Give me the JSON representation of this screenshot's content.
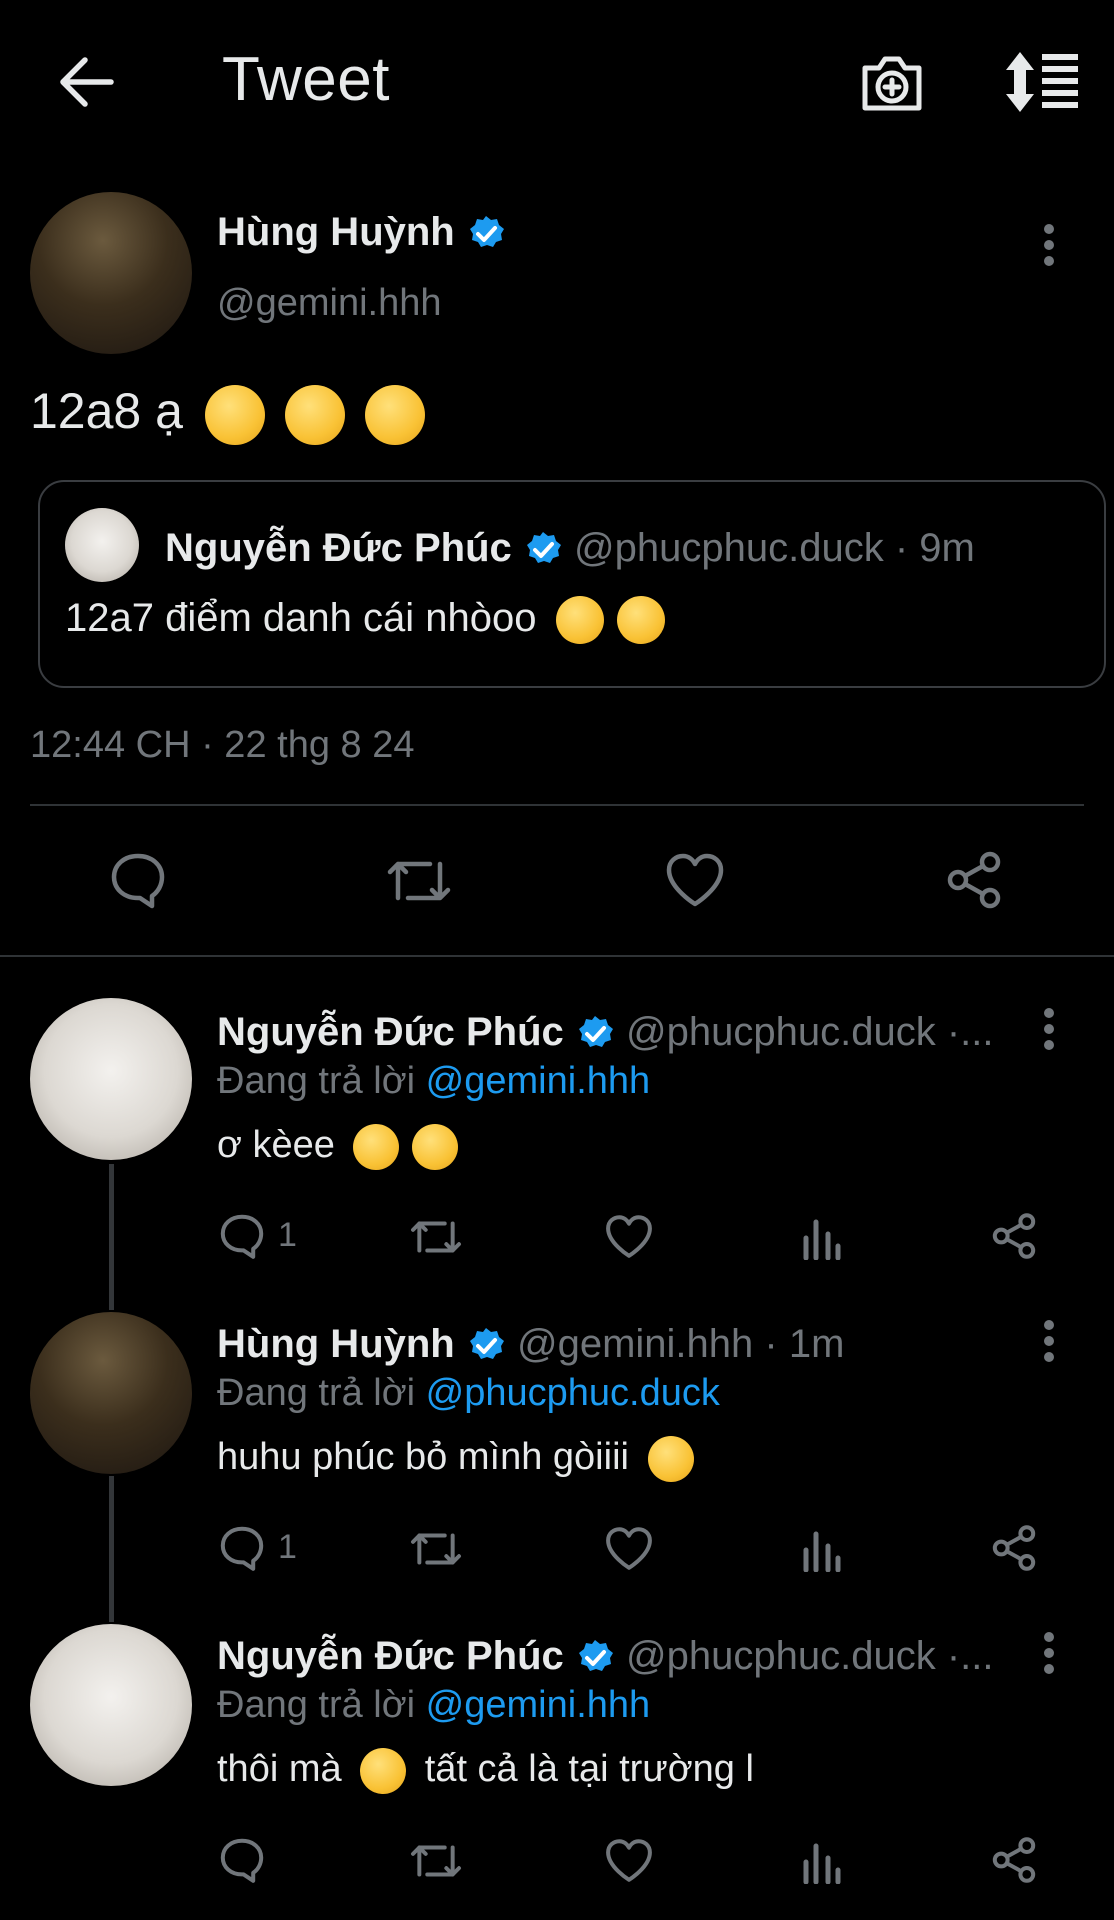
{
  "header": {
    "title": "Tweet"
  },
  "main_tweet": {
    "author_name": "Hùng Huỳnh",
    "handle": "@gemini.hhh",
    "text": "12a8 ạ",
    "emojis": [
      "loudly-crying-face",
      "loudly-crying-face",
      "loudly-crying-face"
    ],
    "timestamp": "12:44 CH · 22 thg 8 24",
    "quoted": {
      "author_name": "Nguyễn Đức Phúc",
      "handle": "@phucphuc.duck",
      "time": "· 9m",
      "text": "12a7 điểm danh cái nhòoo",
      "emojis": [
        "face-savoring-food",
        "face-savoring-food"
      ]
    }
  },
  "replies": [
    {
      "author_name": "Nguyễn Đức Phúc",
      "handle_time": "@phucphuc.duck ·...",
      "replying_prefix": "Đang trả lời",
      "replying_to": "@gemini.hhh",
      "text": "ơ kèee",
      "emojis": [
        "loudly-crying-face",
        "loudly-crying-face"
      ],
      "reply_count": "1"
    },
    {
      "author_name": "Hùng Huỳnh",
      "handle_time": "@gemini.hhh · 1m",
      "replying_prefix": "Đang trả lời",
      "replying_to": "@phucphuc.duck",
      "text": "huhu phúc bỏ mình gòiiii",
      "emojis": [
        "pensive-face"
      ],
      "reply_count": "1"
    },
    {
      "author_name": "Nguyễn Đức Phúc",
      "handle_time": "@phucphuc.duck ·...",
      "replying_prefix": "Đang trả lời",
      "replying_to": "@gemini.hhh",
      "text_before": "thôi mà",
      "text_after": "tất cả là tại trường l",
      "emojis": [
        "disappointed-face"
      ],
      "reply_count": ""
    }
  ],
  "colors": {
    "background": "#000000",
    "text": "#e7e9ea",
    "muted": "#71767b",
    "accent": "#1d9bf0",
    "divider": "#2f3336"
  },
  "icons": [
    "back-arrow-icon",
    "camera-plus-icon",
    "sort-icon",
    "verified-badge-icon",
    "more-icon",
    "reply-icon",
    "retweet-icon",
    "like-icon",
    "share-icon",
    "views-icon"
  ]
}
